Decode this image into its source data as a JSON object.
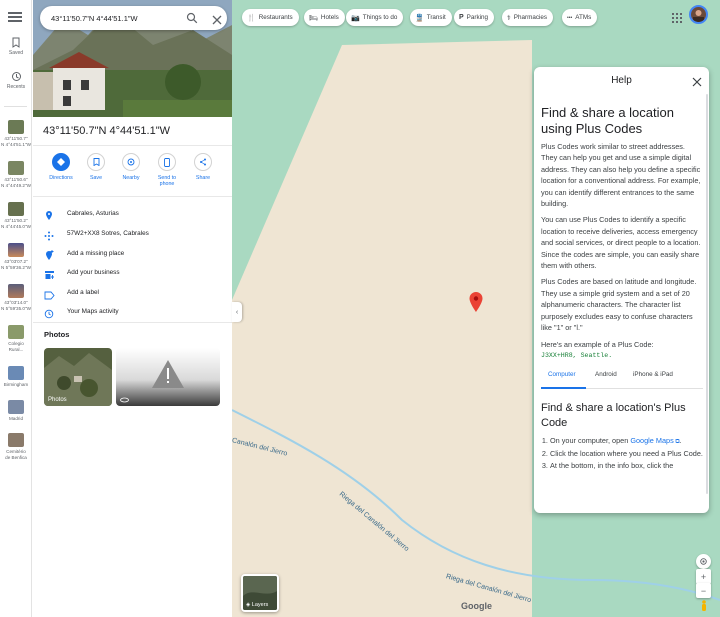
{
  "rail": {
    "saved_label": "Saved",
    "recents_label": "Recents",
    "recent_items": [
      {
        "label": "43°11'50.7\"\nN 4°44'51.1\"W",
        "color": "#6b7a55"
      },
      {
        "label": "43°11'50.6\"\nN 4°44'49.2\"W",
        "color": "#7a8662"
      },
      {
        "label": "43°11'50.2\"\nN 4°44'45.0\"W",
        "color": "#66704e"
      },
      {
        "label": "43°03'07.2\"\nN 5°59'36.2\"W",
        "color": "#4b4f8a"
      },
      {
        "label": "43°03'14.0\"\nN 5°59'35.0\"W",
        "color": "#5b5e7a"
      },
      {
        "label": "Colegio\nRural...",
        "color": "#8a9a6a"
      },
      {
        "label": "Birmingham",
        "color": "#6a8ab5"
      },
      {
        "label": "Madrid",
        "color": "#7a8aa5"
      },
      {
        "label": "Cemitério\nde Benfica",
        "color": "#8a7a6a"
      }
    ]
  },
  "search": {
    "value": "43°11'50.7\"N 4°44'51.1\"W"
  },
  "place": {
    "title": "43°11'50.7\"N 4°44'51.1\"W",
    "actions": [
      {
        "label": "Directions"
      },
      {
        "label": "Save"
      },
      {
        "label": "Nearby"
      },
      {
        "label": "Send to\nphone"
      },
      {
        "label": "Share"
      }
    ],
    "info_rows": [
      {
        "text": "Cabrales, Asturias",
        "icon": "location-pin-icon"
      },
      {
        "text": "57W2+XX8 Sotres, Cabrales",
        "icon": "plus-code-icon"
      },
      {
        "text": "Add a missing place",
        "icon": "add-place-icon"
      },
      {
        "text": "Add your business",
        "icon": "storefront-icon"
      },
      {
        "text": "Add a label",
        "icon": "label-icon"
      },
      {
        "text": "Your Maps activity",
        "icon": "history-icon"
      }
    ],
    "photos_heading": "Photos",
    "photos": [
      {
        "label": "Photos"
      },
      {
        "label": ""
      }
    ]
  },
  "map": {
    "chips": [
      {
        "label": "Restaurants",
        "icon": "🍴"
      },
      {
        "label": "Hotels",
        "icon": "🛏"
      },
      {
        "label": "Things to do",
        "icon": "📷"
      },
      {
        "label": "Transit",
        "icon": "🚆"
      },
      {
        "label": "Parking",
        "icon": "P"
      },
      {
        "label": "Pharmacies",
        "icon": "⚕"
      },
      {
        "label": "ATMs",
        "icon": "•••"
      }
    ],
    "roads": [
      {
        "name": "Canalón del Jierro"
      },
      {
        "name": "Riega del Canalón del Jierro"
      },
      {
        "name": "Riega del Canalón del Jierro"
      }
    ],
    "layers_label": "Layers",
    "logo": "Google",
    "colors": {
      "terrain": "#efe5d3",
      "water_side": "#a9d9c1",
      "pin": "#ea4335",
      "accent": "#1a73e8"
    }
  },
  "help": {
    "header": "Help",
    "title": "Find & share a location using Plus Codes",
    "paragraphs": [
      "Plus Codes work similar to street addresses. They can help you get and use a simple digital address. They can also help you define a specific location for a conventional address. For example, you can identify different entrances to the same building.",
      "You can use Plus Codes to identify a specific location to receive deliveries, access emergency and social services, or direct people to a location. Since the codes are simple, you can easily share them with others.",
      "Plus Codes are based on latitude and longitude. They use a simple grid system and a set of 20 alphanumeric characters. The character list purposely excludes easy to confuse characters like \"1\" or \"l.\"",
      "Here's an example of a Plus Code:"
    ],
    "code_example": "J3XX+HR8, Seattle.",
    "tabs": [
      "Computer",
      "Android",
      "iPhone & iPad"
    ],
    "section_title": "Find & share a location's Plus Code",
    "steps": {
      "s1_prefix": "On your computer, open ",
      "s1_link": "Google Maps",
      "s1_suffix": ".",
      "s2": "Click the location where you need a Plus Code.",
      "s3": "At the bottom, in the info box, click the"
    }
  }
}
